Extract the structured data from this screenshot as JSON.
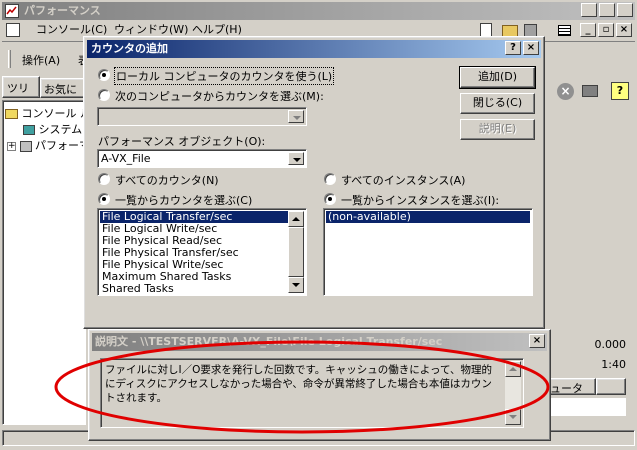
{
  "main_window": {
    "title": "パフォーマンス",
    "menu": [
      "コンソール(C)",
      "ウィンドウ(W)",
      "ヘルプ(H)"
    ],
    "toolbar_label": "操作(A)",
    "toolbar_label2": "表",
    "tree_tabs": [
      "ツリー",
      "お気に入"
    ],
    "tree_items": [
      "コンソール ル",
      "システム",
      "パフォーマ"
    ],
    "right_values": [
      "0.000",
      "1:40"
    ],
    "right_header": "ピュータ"
  },
  "dialog": {
    "title": "カウンタの追加",
    "help_btn": "?",
    "close_btn": "×",
    "radio_local": "ローカル コンピュータのカウンタを使う(L)",
    "radio_remote": "次のコンピュータからカウンタを選ぶ(M):",
    "remote_value": "",
    "btn_add": "追加(D)",
    "btn_close": "閉じる(C)",
    "btn_explain": "説明(E)",
    "object_label": "パフォーマンス オブジェクト(O):",
    "object_value": "A-VX_File",
    "radio_all_counters": "すべてのカウンタ(N)",
    "radio_select_counters": "一覧からカウンタを選ぶ(C)",
    "radio_all_instances": "すべてのインスタンス(A)",
    "radio_select_instances": "一覧からインスタンスを選ぶ(I):",
    "counters": [
      "File Logical Transfer/sec",
      "File Logical Write/sec",
      "File Physical Read/sec",
      "File Physical Transfer/sec",
      "File Physical Write/sec",
      "Maximum Shared Tasks",
      "Shared Tasks"
    ],
    "instances": [
      "(non-available)"
    ]
  },
  "explain": {
    "title": "説明文 - \\\\TESTSERVER\\A-VX_File\\File Logical Transfer/sec",
    "close_btn": "×",
    "text": "ファイルに対しI／O要求を発行した回数です。キャッシュの働きによって、物理的にディスクにアクセスしなかった場合や、命令が異常終了した場合も本値はカウントされます。"
  },
  "colors": {
    "face": "#d4d0c8",
    "active_title": "#0a246a",
    "selection": "#0a246a",
    "annotation": "#e00000"
  }
}
